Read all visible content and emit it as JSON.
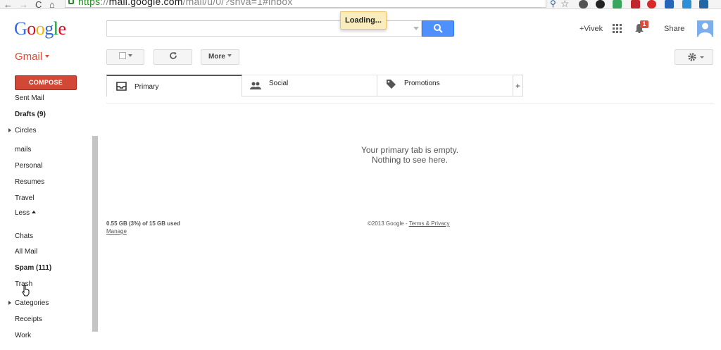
{
  "browser": {
    "url_scheme": "https",
    "url_host": "mail.google.com",
    "url_path": "/mail/u/0/?shva=1#inbox",
    "back_glyph": "←",
    "forward_glyph": "→",
    "reload_glyph": "C",
    "home_glyph": "⌂"
  },
  "header": {
    "logo_letters": [
      "G",
      "o",
      "o",
      "g",
      "l",
      "e"
    ],
    "logo_colors": [
      "#3369e8",
      "#d50f25",
      "#eeb211",
      "#3369e8",
      "#009925",
      "#d50f25"
    ],
    "loading_text": "Loading...",
    "plus_name": "+Vivek",
    "notification_count": "1",
    "share_label": "Share"
  },
  "gmail_label": "Gmail",
  "toolbar": {
    "more_label": "More"
  },
  "sidebar": {
    "compose_label": "COMPOSE",
    "items": [
      {
        "label": "Sent Mail"
      },
      {
        "label": "Drafts (9)"
      },
      {
        "label": "Circles"
      },
      {
        "label": "mails"
      },
      {
        "label": "Personal"
      },
      {
        "label": "Resumes"
      },
      {
        "label": "Travel"
      },
      {
        "label": "Less"
      },
      {
        "label": "Chats"
      },
      {
        "label": "All Mail"
      },
      {
        "label": "Spam (111)"
      },
      {
        "label": "Trash"
      },
      {
        "label": "Categories"
      },
      {
        "label": "Receipts"
      },
      {
        "label": "Work"
      }
    ]
  },
  "tabs": [
    {
      "label": "Primary"
    },
    {
      "label": "Social"
    },
    {
      "label": "Promotions"
    }
  ],
  "add_tab_label": "+",
  "empty_message": {
    "line1": "Your primary tab is empty.",
    "line2": "Nothing to see here."
  },
  "footer": {
    "storage": "0.55 GB (3%) of 15 GB used",
    "manage": "Manage",
    "copyright": "©2013 Google - ",
    "terms": "Terms & Privacy"
  },
  "colors": {
    "accent_blue": "#4d90fe",
    "compose_red": "#d14836",
    "gmail_red": "#dd4b39"
  }
}
